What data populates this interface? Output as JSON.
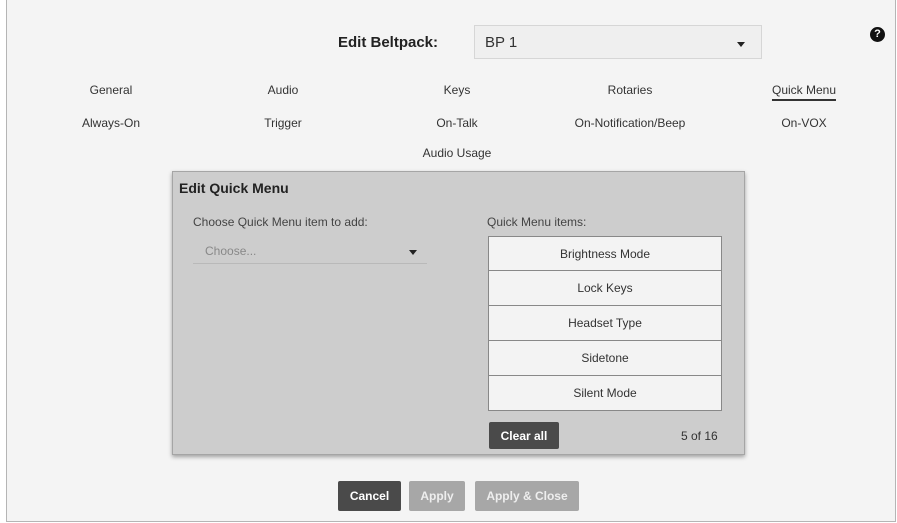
{
  "header": {
    "title": "Edit Beltpack:",
    "beltpack_selected": "BP 1",
    "help_icon": "?"
  },
  "tabs": {
    "row1": [
      "General",
      "Audio",
      "Keys",
      "Rotaries",
      "Quick Menu"
    ],
    "row2": [
      "Always-On",
      "Trigger",
      "On-Talk",
      "On-Notification/Beep",
      "On-VOX"
    ],
    "row3": [
      "Audio Usage"
    ],
    "active": "Quick Menu"
  },
  "panel": {
    "title": "Edit Quick Menu",
    "choose_label": "Choose Quick Menu item to add:",
    "choose_placeholder": "Choose...",
    "items_label": "Quick Menu items:",
    "items": [
      "Brightness Mode",
      "Lock Keys",
      "Headset Type",
      "Sidetone",
      "Silent Mode"
    ],
    "clear_all": "Clear all",
    "count": "5 of 16"
  },
  "footer": {
    "cancel": "Cancel",
    "apply": "Apply",
    "apply_close": "Apply & Close"
  },
  "colors": {
    "dark_button": "#4a4a4a",
    "disabled_button": "#a7a7a7",
    "panel_bg": "#cdcdcd"
  }
}
